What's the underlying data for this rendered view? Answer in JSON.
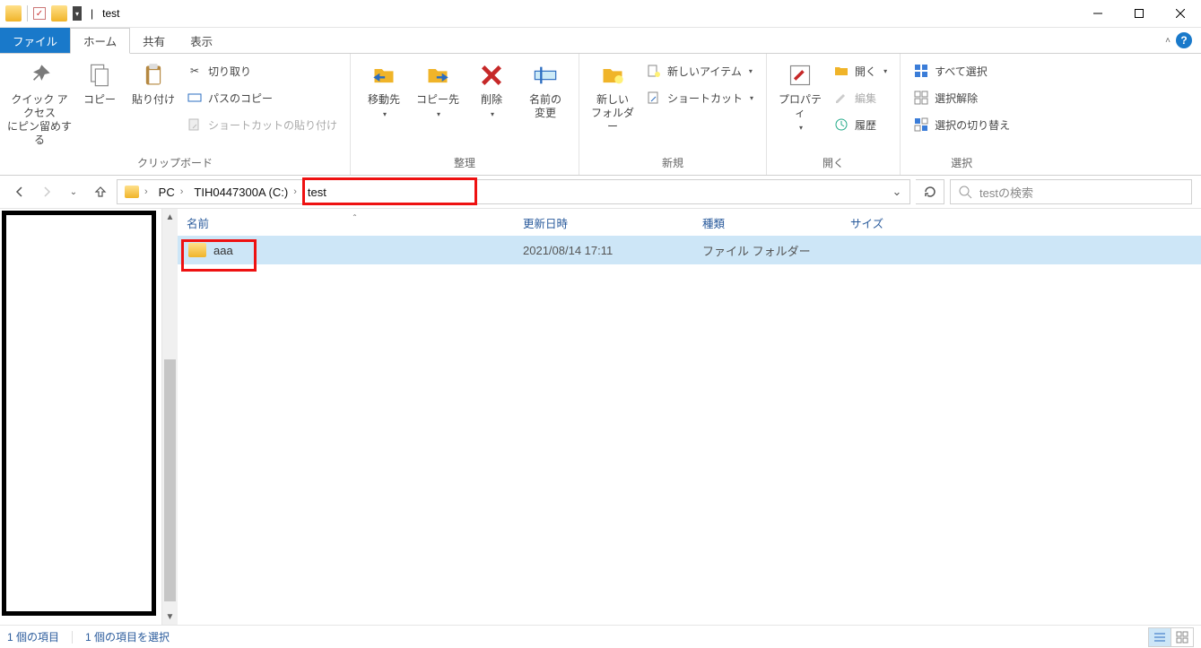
{
  "title": {
    "separator": "|",
    "name": "test"
  },
  "tabs": {
    "file": "ファイル",
    "home": "ホーム",
    "share": "共有",
    "view": "表示"
  },
  "ribbon": {
    "clipboard": {
      "pin": "クイック アクセス\nにピン留めする",
      "copy": "コピー",
      "paste": "貼り付け",
      "cut": "切り取り",
      "copy_path": "パスのコピー",
      "paste_shortcut": "ショートカットの貼り付け",
      "label": "クリップボード"
    },
    "organize": {
      "moveto": "移動先",
      "copyto": "コピー先",
      "delete": "削除",
      "rename": "名前の\n変更",
      "label": "整理"
    },
    "neww": {
      "newfolder": "新しい\nフォルダー",
      "newitem": "新しいアイテム",
      "shortcut": "ショートカット",
      "label": "新規"
    },
    "open": {
      "properties": "プロパティ",
      "open": "開く",
      "edit": "編集",
      "history": "履歴",
      "label": "開く"
    },
    "select": {
      "all": "すべて選択",
      "none": "選択解除",
      "invert": "選択の切り替え",
      "label": "選択"
    }
  },
  "breadcrumb": {
    "pc": "PC",
    "drive": "TIH0447300A (C:)",
    "folder": "test"
  },
  "search": {
    "placeholder": "testの検索"
  },
  "columns": {
    "name": "名前",
    "date": "更新日時",
    "type": "種類",
    "size": "サイズ"
  },
  "rows": [
    {
      "name": "aaa",
      "date": "2021/08/14 17:11",
      "type": "ファイル フォルダー",
      "size": ""
    }
  ],
  "status": {
    "count": "1 個の項目",
    "selected": "1 個の項目を選択"
  }
}
